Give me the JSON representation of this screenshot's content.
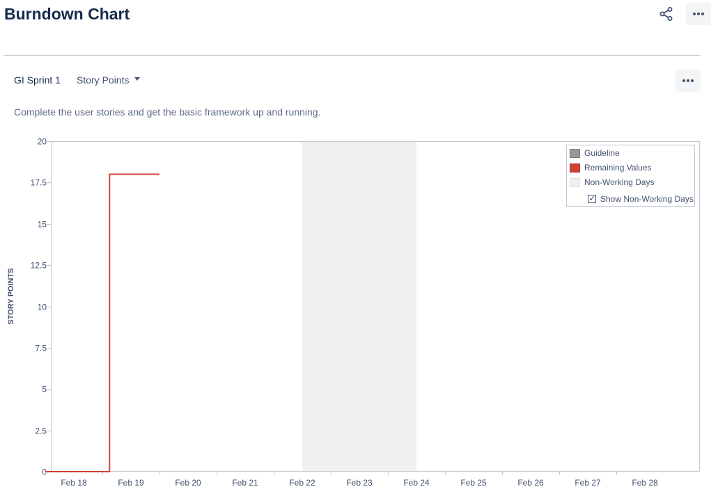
{
  "header": {
    "title": "Burndown Chart",
    "share_icon": "share-icon",
    "more_icon": "ellipsis-icon",
    "more_glyph": "•••"
  },
  "toolbar": {
    "sprint_name": "GI Sprint 1",
    "estimate_selected": "Story Points",
    "more_glyph": "•••"
  },
  "sprint_goal": "Complete the user stories and get the basic framework up and running.",
  "chart_data": {
    "type": "line",
    "title": "",
    "xlabel": "",
    "ylabel": "STORY POINTS",
    "x_ticks": [
      "Feb 18",
      "Feb 19",
      "Feb 20",
      "Feb 21",
      "Feb 22",
      "Feb 23",
      "Feb 24",
      "Feb 25",
      "Feb 26",
      "Feb 27",
      "Feb 28"
    ],
    "x_range": [
      "Feb 17 12:00",
      "Feb 29 12:00"
    ],
    "ylim": [
      0,
      20
    ],
    "y_ticks": [
      "0",
      "2.5",
      "5",
      "7.5",
      "10",
      "12.5",
      "15",
      "17.5",
      "20"
    ],
    "grid": false,
    "legend_position": "top-right",
    "non_working_days": [
      [
        "Feb 22",
        "Feb 24"
      ]
    ],
    "series": [
      {
        "name": "Remaining Values",
        "color": "#d04437",
        "points": [
          {
            "x": "Feb 17 12:00",
            "y": 0
          },
          {
            "x": "Feb 18 15:00",
            "y": 0
          },
          {
            "x": "Feb 18 15:00",
            "y": 18
          },
          {
            "x": "Feb 19 12:00",
            "y": 18
          }
        ]
      }
    ],
    "legend": [
      {
        "label": "Guideline",
        "color": "#999999"
      },
      {
        "label": "Remaining Values",
        "color": "#d04437"
      },
      {
        "label": "Non-Working Days",
        "color": "#f0f0f0"
      }
    ],
    "show_non_working_days": {
      "label": "Show Non-Working Days",
      "checked": true
    }
  }
}
